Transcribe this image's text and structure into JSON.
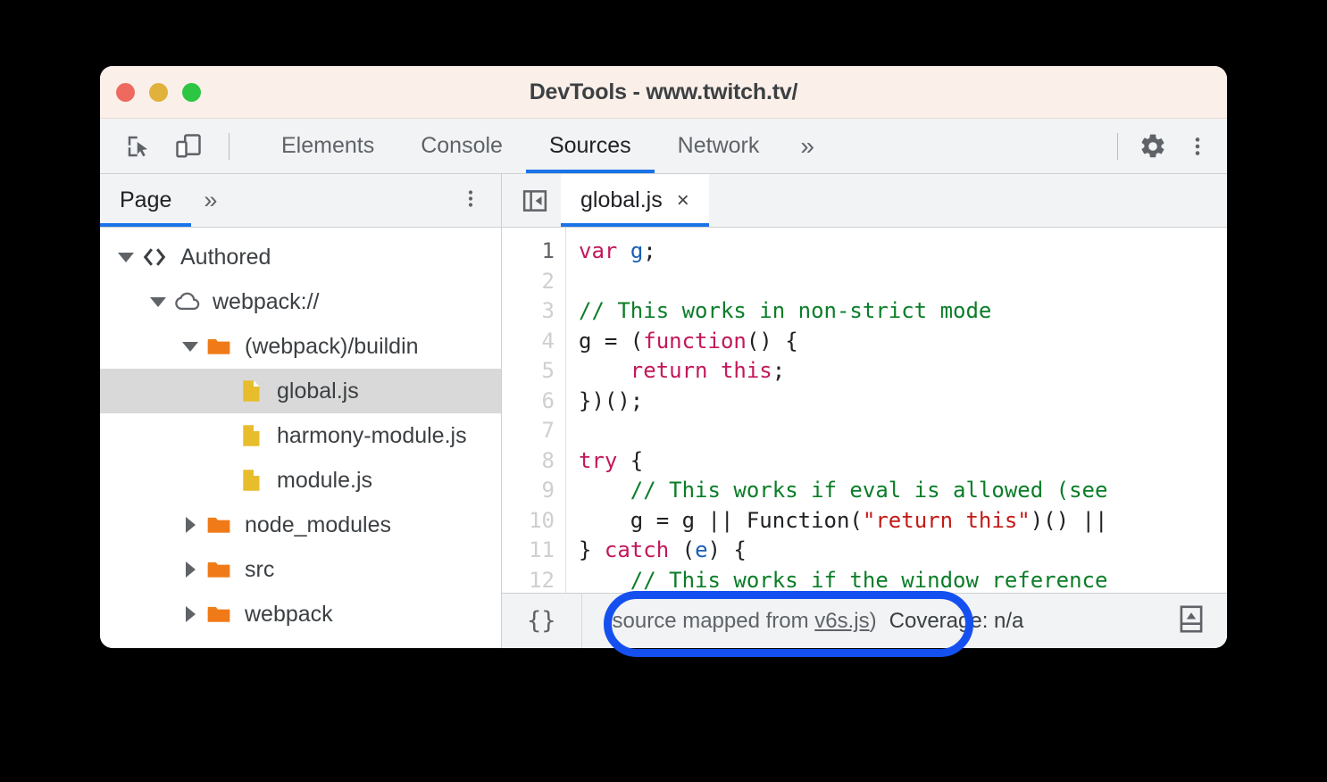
{
  "window": {
    "title": "DevTools - www.twitch.tv/",
    "traffic_lights": [
      "close",
      "minimize",
      "maximize"
    ],
    "colors": {
      "red": "#EE6A5F",
      "yellow": "#E0B23C",
      "green": "#2CC642",
      "accent": "#1a73e8",
      "annotation": "#1450F0"
    }
  },
  "toolbar": {
    "inspect_icon": "inspect-element-icon",
    "device_icon": "device-toolbar-icon",
    "tabs": [
      {
        "label": "Elements",
        "selected": false
      },
      {
        "label": "Console",
        "selected": false
      },
      {
        "label": "Sources",
        "selected": true
      },
      {
        "label": "Network",
        "selected": false
      }
    ],
    "more_tabs_label": "»",
    "settings_icon": "gear-icon",
    "menu_icon": "kebab-menu-icon"
  },
  "sidebar": {
    "tab_label": "Page",
    "more_label": "»",
    "kebab_label": "more-options",
    "tree": [
      {
        "label": "Authored",
        "depth": 0,
        "twisty": "down",
        "icon": "code-tags-icon",
        "selected": false
      },
      {
        "label": "webpack://",
        "depth": 1,
        "twisty": "down",
        "icon": "cloud-icon",
        "selected": false
      },
      {
        "label": "(webpack)/buildin",
        "depth": 2,
        "twisty": "down",
        "icon": "folder-icon",
        "selected": false
      },
      {
        "label": "global.js",
        "depth": 3,
        "twisty": "none",
        "icon": "js-file-icon",
        "selected": true
      },
      {
        "label": "harmony-module.js",
        "depth": 3,
        "twisty": "none",
        "icon": "js-file-icon",
        "selected": false
      },
      {
        "label": "module.js",
        "depth": 3,
        "twisty": "none",
        "icon": "js-file-icon",
        "selected": false
      },
      {
        "label": "node_modules",
        "depth": 2,
        "twisty": "right",
        "icon": "folder-icon",
        "selected": false
      },
      {
        "label": "src",
        "depth": 2,
        "twisty": "right",
        "icon": "folder-icon",
        "selected": false
      },
      {
        "label": "webpack",
        "depth": 2,
        "twisty": "right",
        "icon": "folder-icon",
        "selected": false
      }
    ]
  },
  "editor": {
    "navigator_toggle_icon": "collapse-sidebar-icon",
    "tab_label": "global.js",
    "tab_close_label": "×",
    "line_numbers": [
      "1",
      "2",
      "3",
      "4",
      "5",
      "6",
      "7",
      "8",
      "9",
      "10",
      "11",
      "12"
    ],
    "active_line": 1,
    "code_lines": [
      [
        {
          "t": "var",
          "c": "kw"
        },
        {
          "t": " ",
          "c": ""
        },
        {
          "t": "g",
          "c": "var"
        },
        {
          "t": ";",
          "c": ""
        }
      ],
      [],
      [
        {
          "t": "// This works in non-strict mode",
          "c": "cm"
        }
      ],
      [
        {
          "t": "g = (",
          "c": ""
        },
        {
          "t": "function",
          "c": "kw"
        },
        {
          "t": "() {",
          "c": ""
        }
      ],
      [
        {
          "t": "    ",
          "c": ""
        },
        {
          "t": "return",
          "c": "kw"
        },
        {
          "t": " ",
          "c": ""
        },
        {
          "t": "this",
          "c": "kw"
        },
        {
          "t": ";",
          "c": ""
        }
      ],
      [
        {
          "t": "})();",
          "c": ""
        }
      ],
      [],
      [
        {
          "t": "try",
          "c": "kw"
        },
        {
          "t": " {",
          "c": ""
        }
      ],
      [
        {
          "t": "    ",
          "c": ""
        },
        {
          "t": "// This works if eval is allowed (see",
          "c": "cm"
        }
      ],
      [
        {
          "t": "    g = g || Function(",
          "c": ""
        },
        {
          "t": "\"return this\"",
          "c": "str"
        },
        {
          "t": ")() ||",
          "c": ""
        }
      ],
      [
        {
          "t": "} ",
          "c": ""
        },
        {
          "t": "catch",
          "c": "kw"
        },
        {
          "t": " (",
          "c": ""
        },
        {
          "t": "e",
          "c": "var"
        },
        {
          "t": ") {",
          "c": ""
        }
      ],
      [
        {
          "t": "    ",
          "c": ""
        },
        {
          "t": "// This works if the window reference",
          "c": "cm"
        }
      ]
    ]
  },
  "statusbar": {
    "pretty_print_label": "{}",
    "source_mapped_prefix": "(source mapped from ",
    "source_mapped_link": "v6s.js",
    "source_mapped_suffix": ")",
    "coverage_label": "Coverage: n/a",
    "drawer_icon": "show-drawer-icon"
  }
}
